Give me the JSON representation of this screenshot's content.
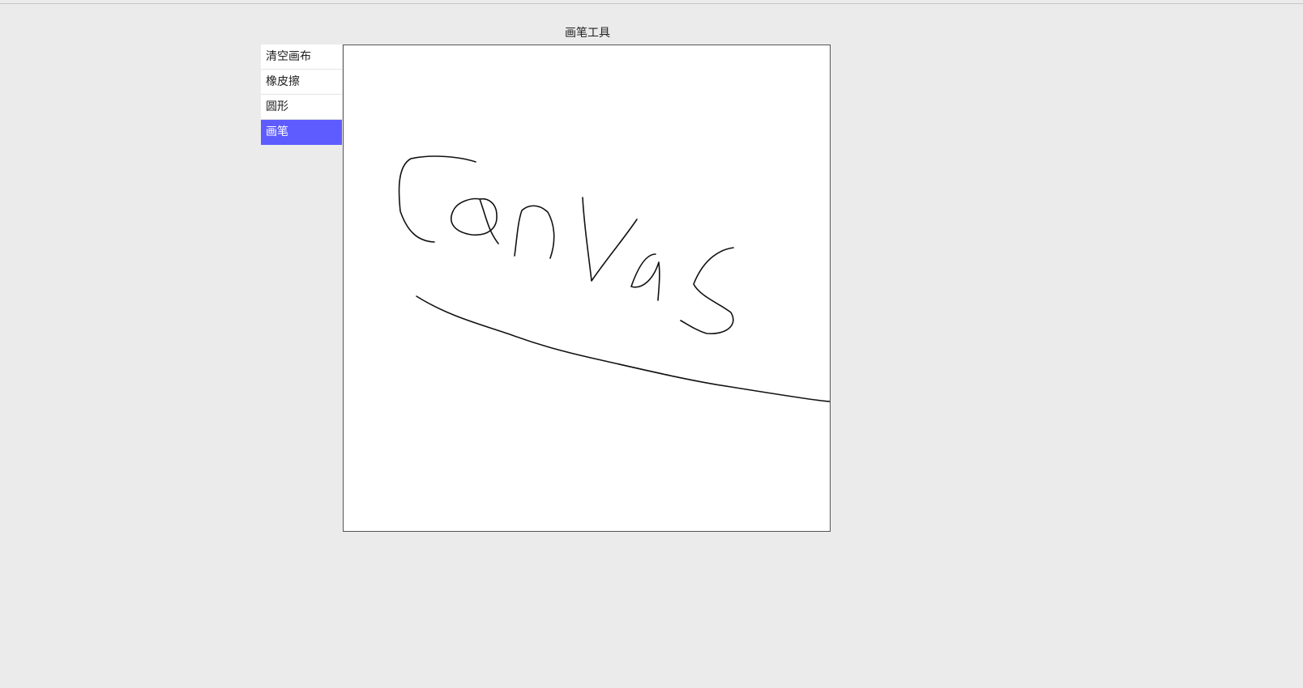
{
  "app": {
    "title": "画笔工具"
  },
  "toolbar": {
    "active_tool": "brush",
    "tools": [
      {
        "id": "clear",
        "label": "清空画布"
      },
      {
        "id": "eraser",
        "label": "橡皮擦"
      },
      {
        "id": "circle",
        "label": "圆形"
      },
      {
        "id": "brush",
        "label": "画笔"
      }
    ],
    "active_color": "#5e5cff"
  },
  "canvas": {
    "stroke_color": "#111111",
    "background": "#ffffff"
  }
}
